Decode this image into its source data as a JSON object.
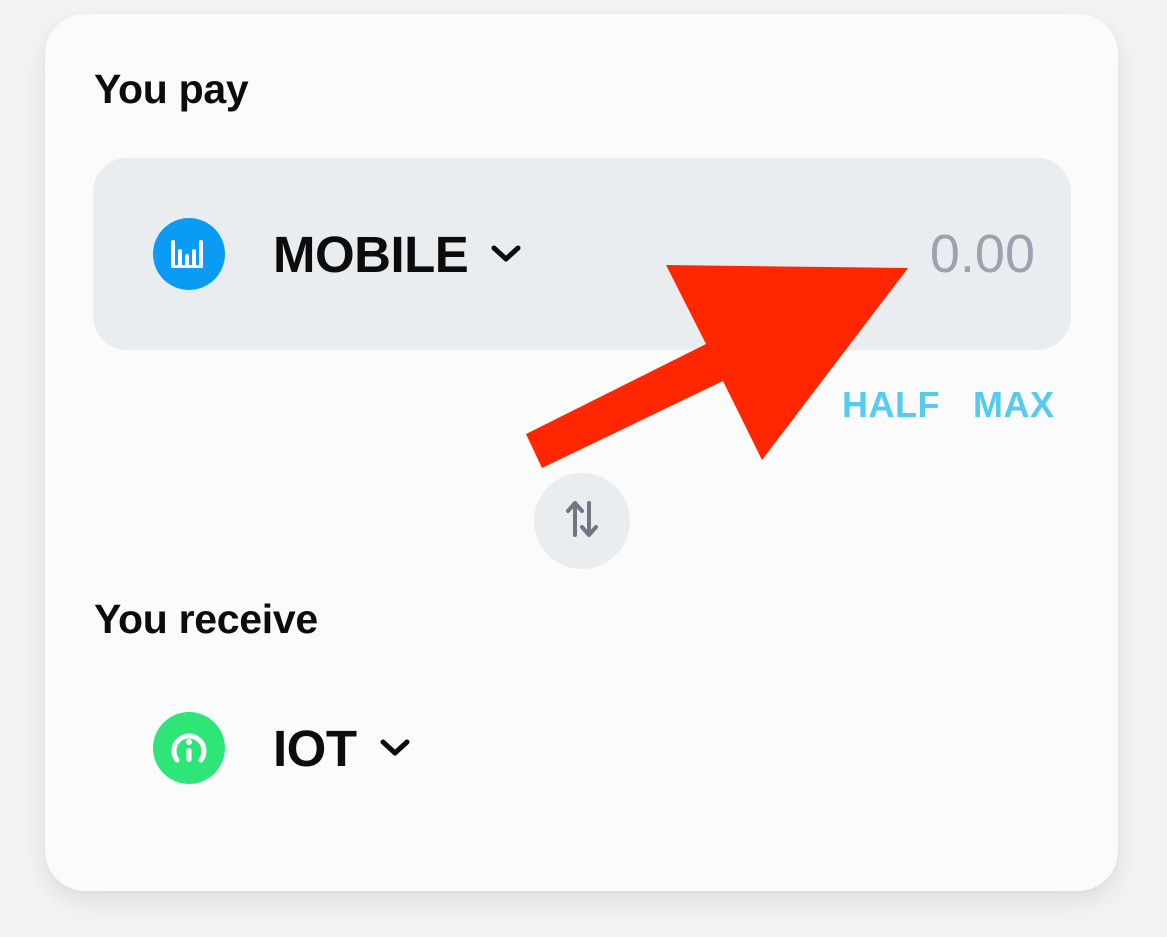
{
  "pay": {
    "label": "You pay",
    "token": {
      "symbol": "MOBILE",
      "icon": "mobile-bars-icon",
      "icon_color": "#0a9bf5"
    },
    "amount_placeholder": "0.00",
    "amount_value": "",
    "half_label": "HALF",
    "max_label": "MAX"
  },
  "swap": {
    "icon": "swap-arrows-icon"
  },
  "receive": {
    "label": "You receive",
    "token": {
      "symbol": "IOT",
      "icon": "iot-antenna-icon",
      "icon_color": "#2ee577"
    }
  },
  "colors": {
    "accent": "#55cbf0",
    "annotation_arrow": "#ff2600",
    "input_bg": "#eaedf0",
    "card_bg": "#fbfbfb",
    "page_bg": "#f2f3f5"
  }
}
